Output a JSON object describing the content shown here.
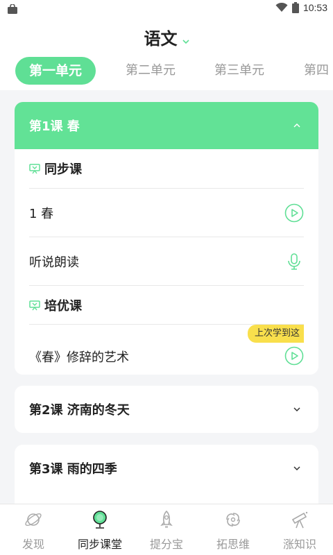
{
  "status_bar": {
    "time": "10:53"
  },
  "header": {
    "title": "语文"
  },
  "tabs": [
    {
      "label": "第一单元",
      "active": true
    },
    {
      "label": "第二单元",
      "active": false
    },
    {
      "label": "第三单元",
      "active": false
    },
    {
      "label": "第四",
      "active": false
    }
  ],
  "lessons": [
    {
      "title": "第1课 春",
      "expanded": true,
      "sections": [
        {
          "title": "同步课",
          "items": [
            {
              "label": "1 春",
              "icon": "play-icon"
            },
            {
              "label": "听说朗读",
              "icon": "microphone-icon"
            }
          ]
        },
        {
          "title": "培优课",
          "items": [
            {
              "label": "《春》修辞的艺术",
              "icon": "play-icon",
              "badge": "上次学到这"
            }
          ]
        }
      ]
    },
    {
      "title": "第2课 济南的冬天",
      "expanded": false
    },
    {
      "title": "第3课 雨的四季",
      "expanded": false
    }
  ],
  "bottom_nav": [
    {
      "label": "发现",
      "icon": "planet-icon",
      "active": false
    },
    {
      "label": "同步课堂",
      "icon": "microphone-stand-icon",
      "active": true
    },
    {
      "label": "提分宝",
      "icon": "rocket-icon",
      "active": false
    },
    {
      "label": "拓思维",
      "icon": "galaxy-icon",
      "active": false
    },
    {
      "label": "涨知识",
      "icon": "telescope-icon",
      "active": false
    }
  ],
  "colors": {
    "accent": "#5fdf95",
    "badge": "#f9df4c",
    "inactive": "#999999"
  }
}
